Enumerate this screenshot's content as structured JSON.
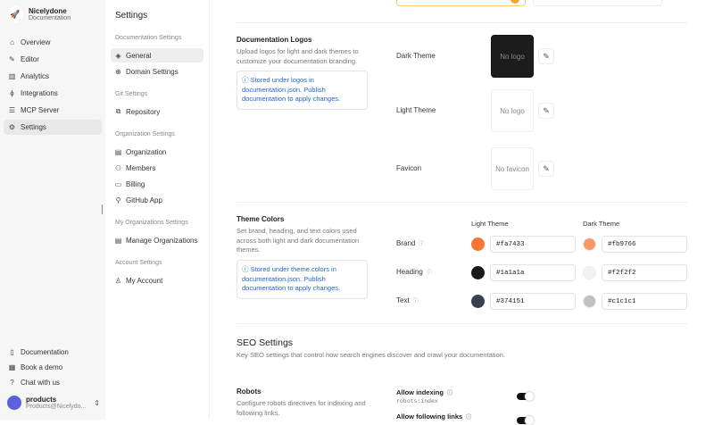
{
  "app": {
    "name": "Nicelydone",
    "subtitle": "Documentation"
  },
  "nav": [
    {
      "label": "Overview",
      "icon": "⌂"
    },
    {
      "label": "Editor",
      "icon": "✎"
    },
    {
      "label": "Analytics",
      "icon": "▥"
    },
    {
      "label": "Integrations",
      "icon": "ϕ"
    },
    {
      "label": "MCP Server",
      "icon": "☰"
    },
    {
      "label": "Settings",
      "icon": "⚙"
    }
  ],
  "footer": [
    {
      "label": "Documentation",
      "icon": "▯"
    },
    {
      "label": "Book a demo",
      "icon": "▦"
    },
    {
      "label": "Chat with us",
      "icon": "?"
    }
  ],
  "user": {
    "name": "products",
    "email": "Products@Nicelydo..."
  },
  "settings": {
    "title": "Settings",
    "groups": [
      {
        "title": "Documentation Settings",
        "items": [
          {
            "label": "General",
            "icon": "◈"
          },
          {
            "label": "Domain Settings",
            "icon": "⊕"
          }
        ]
      },
      {
        "title": "Git Settings",
        "items": [
          {
            "label": "Repository",
            "icon": "⧉"
          }
        ]
      },
      {
        "title": "Organization Settings",
        "items": [
          {
            "label": "Organization",
            "icon": "▤"
          },
          {
            "label": "Members",
            "icon": "⚇"
          },
          {
            "label": "Billing",
            "icon": "▭"
          },
          {
            "label": "GitHub App",
            "icon": "⚲"
          }
        ]
      },
      {
        "title": "My Organizations Settings",
        "items": [
          {
            "label": "Manage Organizations",
            "icon": "▤"
          }
        ]
      },
      {
        "title": "Account Settings",
        "items": [
          {
            "label": "My Account",
            "icon": "♙"
          }
        ]
      }
    ]
  },
  "logos": {
    "title": "Documentation Logos",
    "desc": "Upload logos for light and dark themes to customize your documentation branding.",
    "note": "ⓘ Stored under logos in documentation.json. Publish documentation to apply changes.",
    "rows": [
      {
        "label": "Dark Theme",
        "placeholder": "No logo"
      },
      {
        "label": "Light Theme",
        "placeholder": "No logo"
      },
      {
        "label": "Favicon",
        "placeholder": "No favicon"
      }
    ]
  },
  "colors": {
    "title": "Theme Colors",
    "desc": "Set brand, heading, and text colors used across both light and dark documentation themes.",
    "note": "ⓘ Stored under theme.colors in documentation.json. Publish documentation to apply changes.",
    "light_header": "Light Theme",
    "dark_header": "Dark Theme",
    "rows": [
      {
        "label": "Brand",
        "light": "#fa7433",
        "dark": "#fb9766"
      },
      {
        "label": "Heading",
        "light": "#1a1a1a",
        "dark": "#f2f2f2"
      },
      {
        "label": "Text",
        "light": "#374151",
        "dark": "#c1c1c1"
      }
    ]
  },
  "seo": {
    "title": "SEO Settings",
    "desc": "Key SEO settings that control how search engines discover and crawl your documentation.",
    "robots_title": "Robots",
    "robots_desc": "Configure robots directives for indexing and following links.",
    "toggles": [
      {
        "label": "Allow indexing",
        "code": "robots:index",
        "on": true
      },
      {
        "label": "Allow following links",
        "on": true
      }
    ]
  }
}
